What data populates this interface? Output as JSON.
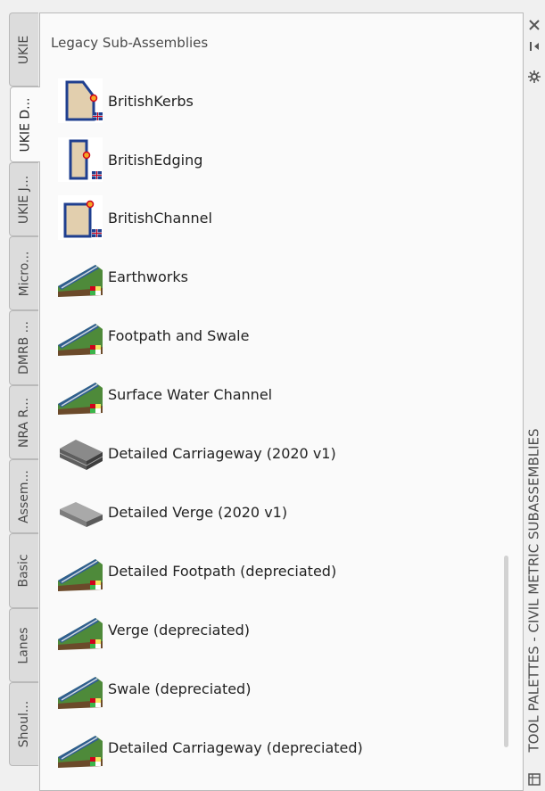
{
  "tabs": [
    {
      "label": "UKIE",
      "active": false
    },
    {
      "label": "UKIE D...",
      "active": true
    },
    {
      "label": "UKIE J...",
      "active": false
    },
    {
      "label": "Micro...",
      "active": false
    },
    {
      "label": "DMRB ...",
      "active": false
    },
    {
      "label": "NRA R...",
      "active": false
    },
    {
      "label": "Assem...",
      "active": false
    },
    {
      "label": "Basic",
      "active": false
    },
    {
      "label": "Lanes",
      "active": false
    },
    {
      "label": "Shoul...",
      "active": false
    }
  ],
  "palette": {
    "section_title": "Legacy Sub-Assemblies",
    "items": [
      {
        "label": "BritishKerbs",
        "icon": "british-kerb-icon"
      },
      {
        "label": "BritishEdging",
        "icon": "british-edging-icon"
      },
      {
        "label": "BritishChannel",
        "icon": "british-channel-icon"
      },
      {
        "label": "Earthworks",
        "icon": "subassembly-road-icon"
      },
      {
        "label": "Footpath and Swale",
        "icon": "subassembly-road-icon"
      },
      {
        "label": "Surface Water Channel",
        "icon": "subassembly-road-icon"
      },
      {
        "label": "Detailed Carriageway (2020 v1)",
        "icon": "carriageway-slab-icon"
      },
      {
        "label": "Detailed Verge (2020 v1)",
        "icon": "verge-slab-icon"
      },
      {
        "label": "Detailed Footpath (depreciated)",
        "icon": "subassembly-road-icon"
      },
      {
        "label": "Verge (depreciated)",
        "icon": "subassembly-road-icon"
      },
      {
        "label": "Swale (depreciated)",
        "icon": "subassembly-road-icon"
      },
      {
        "label": "Detailed Carriageway (depreciated)",
        "icon": "subassembly-road-icon"
      }
    ]
  },
  "titlebar": {
    "title": "TOOL PALETTES - CIVIL METRIC SUBASSEMBLIES",
    "close_icon": "close-icon",
    "autohide_icon": "auto-hide-icon",
    "properties_icon": "properties-icon"
  },
  "colors": {
    "kerb_fill": "#e2cfae",
    "kerb_stroke": "#1f3f8f",
    "node_fill": "#f5a623",
    "node_stroke": "#d0021b"
  }
}
